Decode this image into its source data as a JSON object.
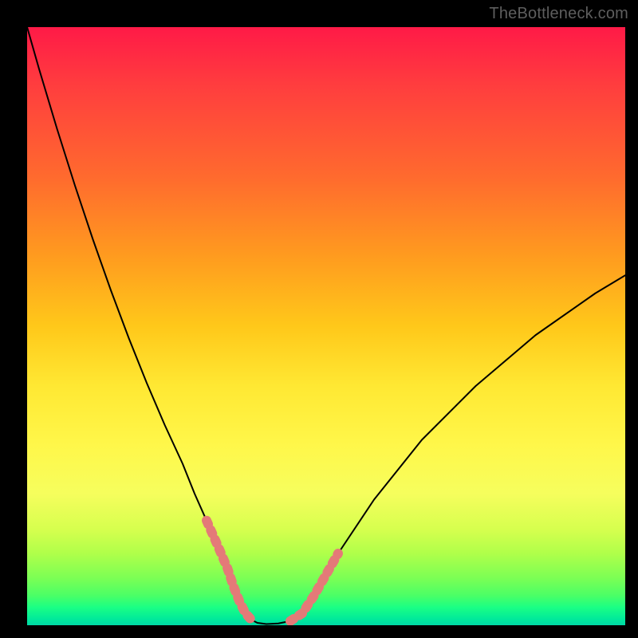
{
  "watermark": "TheBottleneck.com",
  "chart_data": {
    "type": "line",
    "title": "",
    "xlabel": "",
    "ylabel": "",
    "xlim": [
      0,
      100
    ],
    "ylim": [
      0,
      100
    ],
    "series": [
      {
        "name": "curve",
        "x": [
          0,
          2,
          5,
          8,
          11,
          14,
          17,
          20,
          23,
          26,
          28,
          30,
          32,
          33.5,
          34.5,
          35.5,
          36.5,
          37.5,
          38.5,
          40,
          42,
          44,
          46,
          48,
          52,
          58,
          66,
          75,
          85,
          95,
          100
        ],
        "y": [
          100,
          93,
          83,
          73.5,
          64.5,
          56,
          48,
          40.5,
          33.5,
          27,
          22,
          17.5,
          13,
          9.5,
          6.5,
          4,
          2,
          0.9,
          0.4,
          0.2,
          0.3,
          0.7,
          2,
          5,
          12,
          21,
          31,
          40,
          48.5,
          55.5,
          58.5
        ]
      }
    ],
    "highlight_segments": [
      {
        "start_index": 11,
        "end_index": 17
      },
      {
        "start_index": 21,
        "end_index": 24
      }
    ],
    "colors": {
      "curve_stroke": "#000000",
      "highlight_stroke": "#e47a78"
    }
  }
}
